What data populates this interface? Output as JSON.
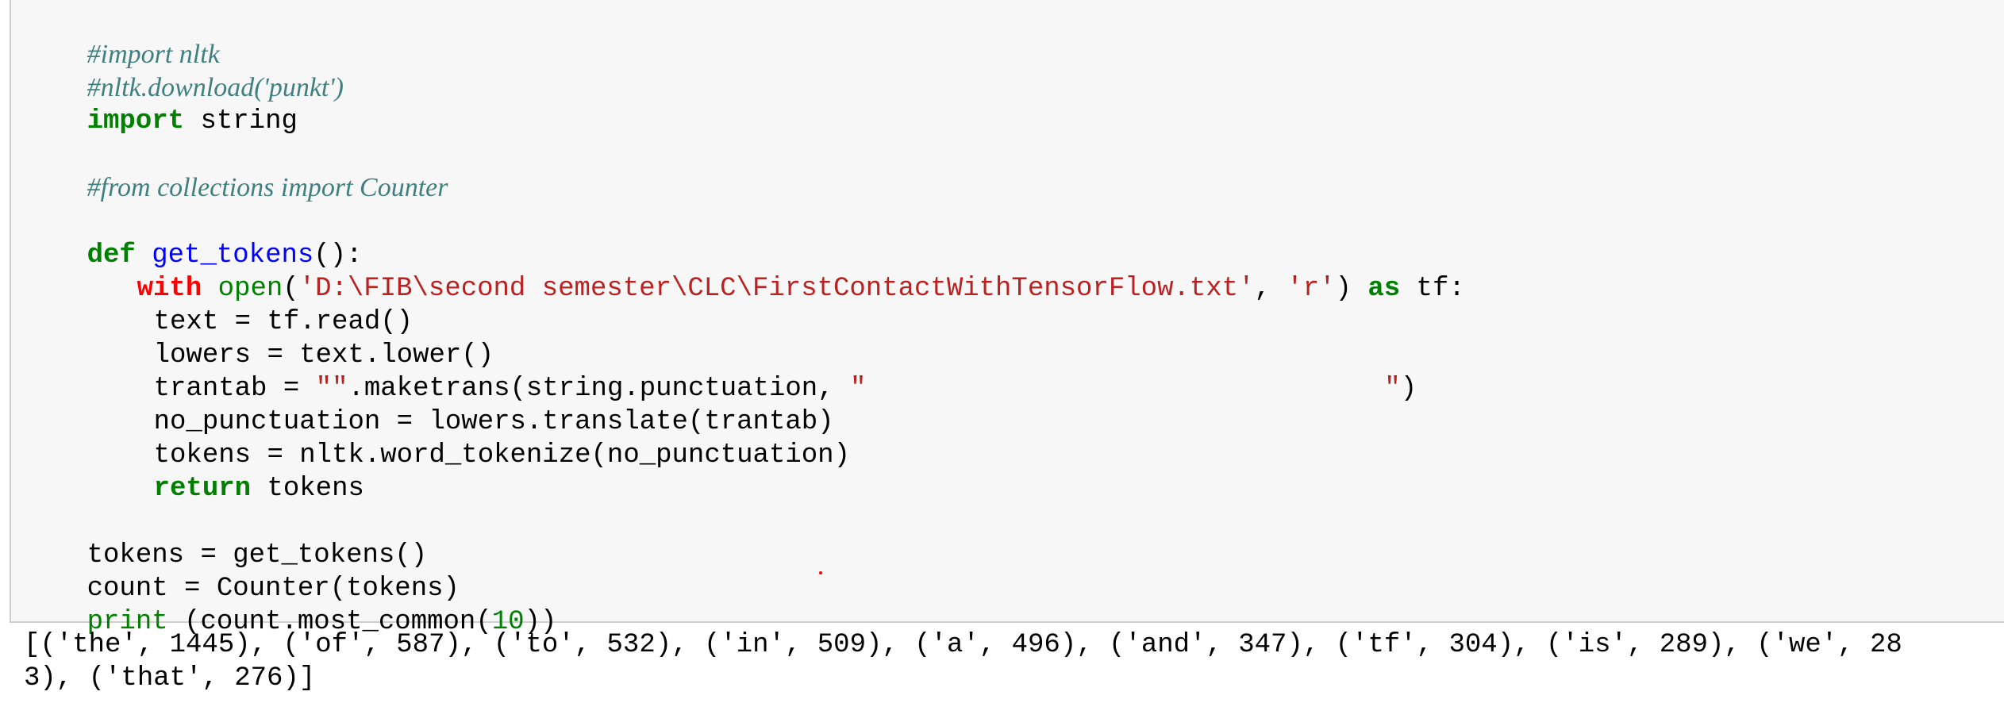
{
  "code_cell": {
    "line1": {
      "comment": "#import nltk"
    },
    "line2": {
      "comment": "#nltk.download('punkt')"
    },
    "line3": {
      "kw": "import",
      "rest": " string"
    },
    "line5": {
      "comment": "#from collections import Counter"
    },
    "line7": {
      "kw": "def",
      "sp": " ",
      "fn": "get_tokens",
      "rest": "():"
    },
    "line8": {
      "kw_with": "with",
      "sp1": " ",
      "bi_open": "open",
      "p1": "(",
      "path": "'D:\\FIB\\second semester\\CLC\\FirstContactWithTensorFlow.txt'",
      "comma": ", ",
      "mode": "'r'",
      "p2": ") ",
      "kw_as": "as",
      "rest": " tf:"
    },
    "line9": {
      "text": "text = tf.read()"
    },
    "line10": {
      "text": "lowers = text.lower()"
    },
    "line11": {
      "pre": "trantab = ",
      "s1": "\"\"",
      "mid": ".maketrans(string.punctuation, ",
      "s2": "\"                                \"",
      "post": ")"
    },
    "line12": {
      "text": "no_punctuation = lowers.translate(trantab)"
    },
    "line13": {
      "text": "tokens = nltk.word_tokenize(no_punctuation)"
    },
    "line14": {
      "kw": "return",
      "rest": " tokens"
    },
    "line16": {
      "text": "tokens = get_tokens()"
    },
    "line17": {
      "text": "count = Counter(tokens)"
    },
    "line18": {
      "bi": "print",
      "pre": " (count.most_common(",
      "num": "10",
      "post": "))"
    }
  },
  "output": {
    "line1": "[('the', 1445), ('of', 587), ('to', 532), ('in', 509), ('a', 496), ('and', 347), ('tf', 304), ('is', 289), ('we', 28",
    "line2": "3), ('that', 276)]"
  },
  "colors": {
    "cell_background": "#f7f7f7",
    "cell_border": "#cfcfcf",
    "keyword": "#008000",
    "keyword_with": "#ff0000",
    "function_name": "#0000ff",
    "string": "#ba2121",
    "comment": "#408080"
  }
}
